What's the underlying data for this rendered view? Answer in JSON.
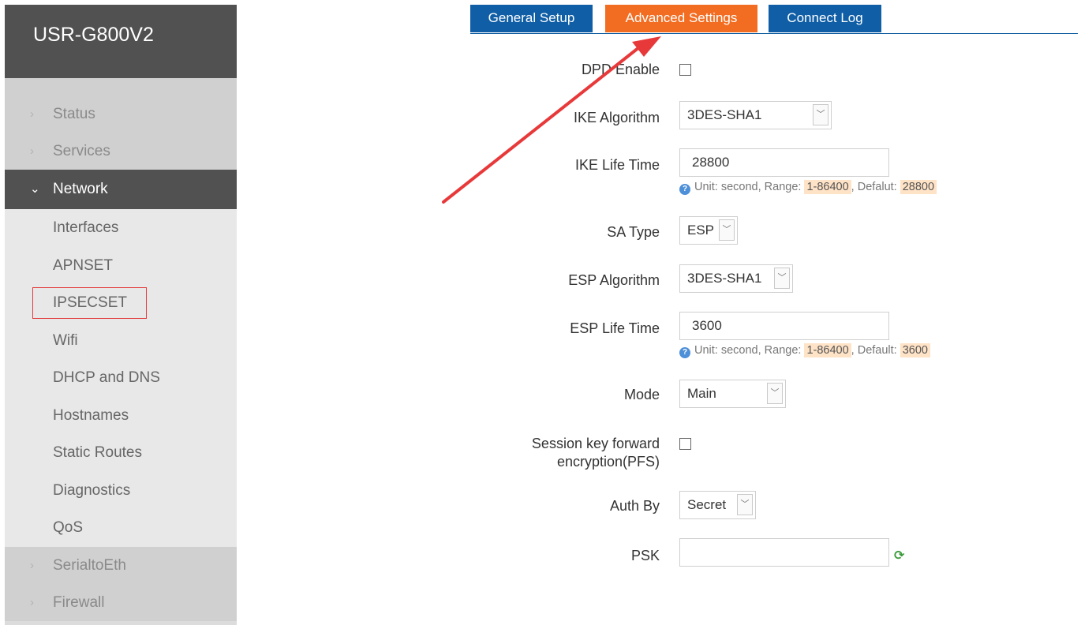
{
  "sidebar": {
    "brand": "USR-G800V2",
    "top_items": [
      {
        "label": "Status",
        "icon": "chevron-right-icon"
      },
      {
        "label": "Services",
        "icon": "chevron-right-icon"
      }
    ],
    "active_section": {
      "label": "Network",
      "icon": "chevron-down-icon"
    },
    "network_items": [
      {
        "label": "Interfaces"
      },
      {
        "label": "APNSET"
      },
      {
        "label": "IPSECSET"
      },
      {
        "label": "Wifi"
      },
      {
        "label": "DHCP and DNS"
      },
      {
        "label": "Hostnames"
      },
      {
        "label": "Static Routes"
      },
      {
        "label": "Diagnostics"
      },
      {
        "label": "QoS"
      }
    ],
    "bottom_items": [
      {
        "label": "SerialtoEth",
        "icon": "chevron-right-icon"
      },
      {
        "label": "Firewall",
        "icon": "chevron-right-icon"
      }
    ]
  },
  "tabs": [
    {
      "label": "General Setup",
      "color": "#0f5ea6"
    },
    {
      "label": "Advanced Settings",
      "color": "#f26d21",
      "active": true
    },
    {
      "label": "Connect Log",
      "color": "#0f5ea6"
    }
  ],
  "form": {
    "dpd_enable": {
      "label": "DPD Enable",
      "checked": false
    },
    "ike_algorithm": {
      "label": "IKE Algorithm",
      "value": "3DES-SHA1"
    },
    "ike_life_time": {
      "label": "IKE Life Time",
      "value": "28800",
      "hint_prefix": "Unit: second, Range:",
      "hint_range": "1-86400",
      "hint_default_label": ", Defalut:",
      "hint_default": "28800"
    },
    "sa_type": {
      "label": "SA Type",
      "value": "ESP"
    },
    "esp_algorithm": {
      "label": "ESP Algorithm",
      "value": "3DES-SHA1"
    },
    "esp_life_time": {
      "label": "ESP Life Time",
      "value": "3600",
      "hint_prefix": "Unit: second, Range:",
      "hint_range": "1-86400",
      "hint_default_label": ", Default:",
      "hint_default": "3600"
    },
    "mode": {
      "label": "Mode",
      "value": "Main"
    },
    "pfs": {
      "label_line1": "Session key forward",
      "label_line2": "encryption(PFS)",
      "checked": false
    },
    "auth_by": {
      "label": "Auth By",
      "value": "Secret"
    },
    "psk": {
      "label": "PSK",
      "value": ""
    }
  },
  "annotation": {
    "color": "#e8393a"
  },
  "colors": {
    "sidebar_dark": "#515151",
    "tab_blue": "#0f5ea6",
    "tab_orange": "#f26d21"
  }
}
